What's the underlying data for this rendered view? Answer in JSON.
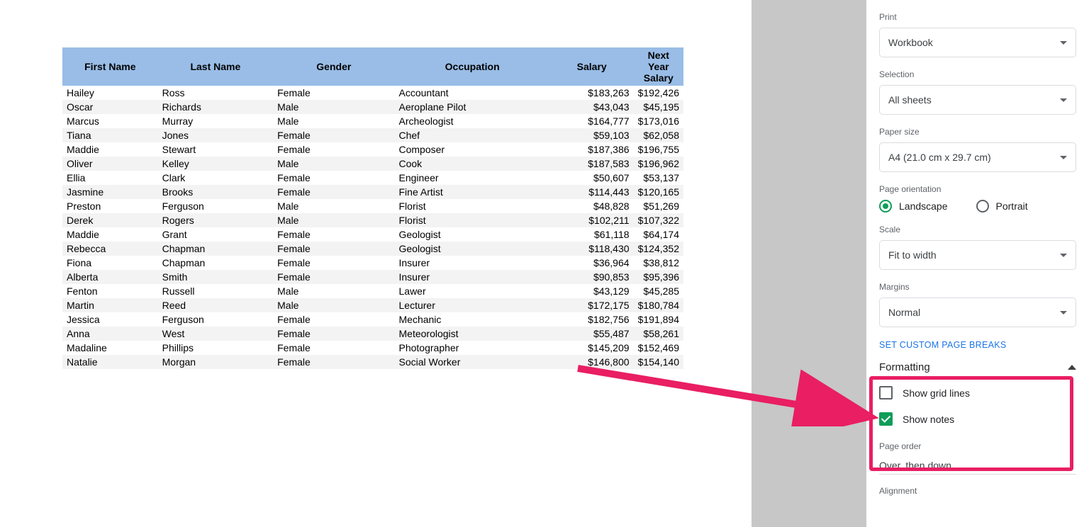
{
  "table": {
    "headers": [
      "First Name",
      "Last Name",
      "Gender",
      "Occupation",
      "Salary",
      "Next Year Salary"
    ],
    "rows": [
      [
        "Hailey",
        "Ross",
        "Female",
        "Accountant",
        "$183,263",
        "$192,426"
      ],
      [
        "Oscar",
        "Richards",
        "Male",
        "Aeroplane Pilot",
        "$43,043",
        "$45,195"
      ],
      [
        "Marcus",
        "Murray",
        "Male",
        "Archeologist",
        "$164,777",
        "$173,016"
      ],
      [
        "Tiana",
        "Jones",
        "Female",
        "Chef",
        "$59,103",
        "$62,058"
      ],
      [
        "Maddie",
        "Stewart",
        "Female",
        "Composer",
        "$187,386",
        "$196,755"
      ],
      [
        "Oliver",
        "Kelley",
        "Male",
        "Cook",
        "$187,583",
        "$196,962"
      ],
      [
        "Ellia",
        "Clark",
        "Female",
        "Engineer",
        "$50,607",
        "$53,137"
      ],
      [
        "Jasmine",
        "Brooks",
        "Female",
        "Fine Artist",
        "$114,443",
        "$120,165"
      ],
      [
        "Preston",
        "Ferguson",
        "Male",
        "Florist",
        "$48,828",
        "$51,269"
      ],
      [
        "Derek",
        "Rogers",
        "Male",
        "Florist",
        "$102,211",
        "$107,322"
      ],
      [
        "Maddie",
        "Grant",
        "Female",
        "Geologist",
        "$61,118",
        "$64,174"
      ],
      [
        "Rebecca",
        "Chapman",
        "Female",
        "Geologist",
        "$118,430",
        "$124,352"
      ],
      [
        "Fiona",
        "Chapman",
        "Female",
        "Insurer",
        "$36,964",
        "$38,812"
      ],
      [
        "Alberta",
        "Smith",
        "Female",
        "Insurer",
        "$90,853",
        "$95,396"
      ],
      [
        "Fenton",
        "Russell",
        "Male",
        "Lawer",
        "$43,129",
        "$45,285"
      ],
      [
        "Martin",
        "Reed",
        "Male",
        "Lecturer",
        "$172,175",
        "$180,784"
      ],
      [
        "Jessica",
        "Ferguson",
        "Female",
        "Mechanic",
        "$182,756",
        "$191,894"
      ],
      [
        "Anna",
        "West",
        "Female",
        "Meteorologist",
        "$55,487",
        "$58,261"
      ],
      [
        "Madaline",
        "Phillips",
        "Female",
        "Photographer",
        "$145,209",
        "$152,469"
      ],
      [
        "Natalie",
        "Morgan",
        "Female",
        "Social Worker",
        "$146,800",
        "$154,140"
      ]
    ]
  },
  "sidebar": {
    "print_label": "Print",
    "print_value": "Workbook",
    "selection_label": "Selection",
    "selection_value": "All sheets",
    "paper_label": "Paper size",
    "paper_value": "A4 (21.0 cm x 29.7 cm)",
    "orientation_label": "Page orientation",
    "orientation_landscape": "Landscape",
    "orientation_portrait": "Portrait",
    "scale_label": "Scale",
    "scale_value": "Fit to width",
    "margins_label": "Margins",
    "margins_value": "Normal",
    "custom_breaks": "SET CUSTOM PAGE BREAKS",
    "formatting_header": "Formatting",
    "show_grid": "Show grid lines",
    "show_notes": "Show notes",
    "page_order_label": "Page order",
    "page_order_value": "Over, then down",
    "alignment_label": "Alignment"
  }
}
